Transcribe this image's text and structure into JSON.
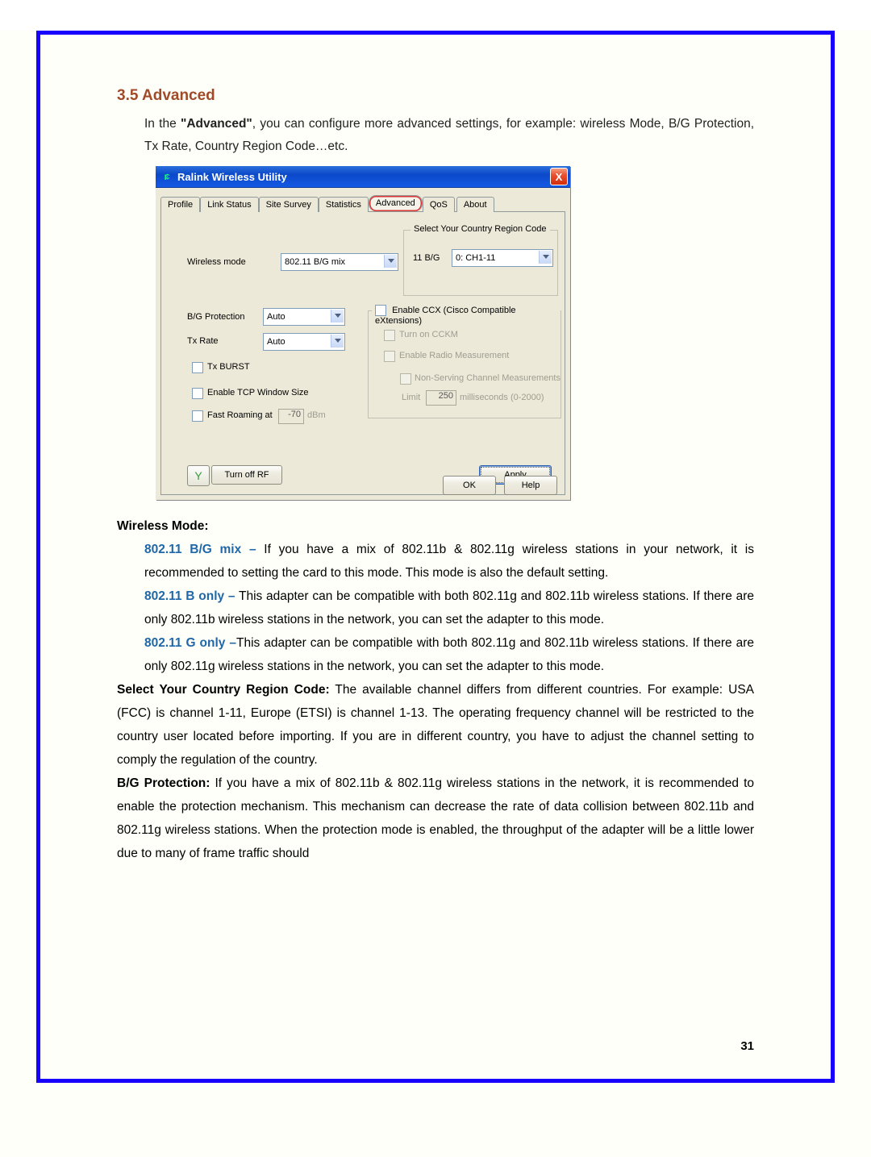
{
  "heading": "3.5 Advanced",
  "intro_prefix": "In the ",
  "intro_bold": "\"Advanced\"",
  "intro_rest": ", you can configure more advanced settings, for example: wireless Mode, B/G Protection, Tx Rate, Country Region Code…etc.",
  "window": {
    "title": "Ralink Wireless Utility",
    "close": "X",
    "tabs": {
      "profile": "Profile",
      "link": "Link Status",
      "site": "Site Survey",
      "stats": "Statistics",
      "advanced": "Advanced",
      "qos": "QoS",
      "about": "About"
    },
    "wireless_mode_label": "Wireless mode",
    "wireless_mode_value": "802.11 B/G mix",
    "region_group": "Select Your Country Region Code",
    "region_bg_label": "11 B/G",
    "region_bg_value": "0: CH1-11",
    "bg_protection_label": "B/G Protection",
    "bg_protection_value": "Auto",
    "tx_rate_label": "Tx Rate",
    "tx_rate_value": "Auto",
    "tx_burst": "Tx BURST",
    "tcp_window": "Enable TCP Window Size",
    "fast_roaming": "Fast Roaming at",
    "fast_roaming_value": "-70",
    "fast_roaming_unit": "dBm",
    "ccx_group": "Enable CCX (Cisco Compatible eXtensions)",
    "cckm": "Turn on CCKM",
    "radio_meas": "Enable Radio Measurement",
    "nonserving": "Non-Serving Channel Measurements",
    "limit_label": "Limit",
    "limit_value": "250",
    "limit_unit": "milliseconds (0-2000)",
    "turn_off_rf": "Turn off RF",
    "apply": "Apply",
    "ok": "OK",
    "help": "Help"
  },
  "text": {
    "wm_label": "Wireless Mode:",
    "bgmix_opt": "802.11 B/G mix –",
    "bgmix_txt": " If you have a mix of 802.11b & 802.11g wireless stations in your network, it is recommended to setting the card to this mode. This mode is also the default setting.",
    "bonly_opt": "802.11 B only –",
    "bonly_txt": " This adapter can be compatible with both 802.11g and 802.11b wireless stations. If there are only 802.11b wireless stations in the network, you can set the adapter to this mode.",
    "gonly_opt": "802.11 G only –",
    "gonly_txt": "This adapter can be compatible with both 802.11g and 802.11b wireless stations. If there are only 802.11g wireless stations in the network, you can set the adapter to this mode.",
    "region_label": "Select Your Country Region Code:",
    "region_txt": " The available channel differs from different countries. For example: USA (FCC) is channel 1-11, Europe (ETSI) is channel 1-13. The operating frequency channel will be restricted to the country user located before importing. If you are in different country, you have to adjust the channel setting to comply the regulation of the country.",
    "bgp_label": "B/G Protection:",
    "bgp_txt": " If you have a mix of 802.11b & 802.11g wireless stations in the network, it is recommended to enable the protection mechanism. This mechanism can decrease the rate of data collision between 802.11b and 802.11g wireless stations. When the protection mode is enabled, the throughput of the adapter will be a little lower due to many of frame traffic should"
  },
  "page_number": "31"
}
